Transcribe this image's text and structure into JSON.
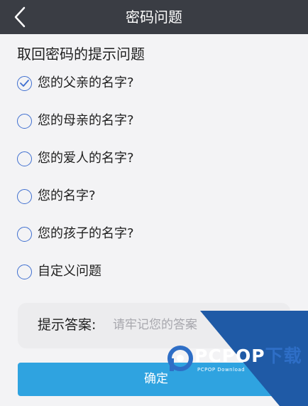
{
  "header": {
    "title": "密码问题",
    "back_icon": "chevron-left-icon"
  },
  "section": {
    "title": "取回密码的提示问题"
  },
  "options": [
    {
      "label": "您的父亲的名字?",
      "selected": true
    },
    {
      "label": "您的母亲的名字?",
      "selected": false
    },
    {
      "label": "您的爱人的名字?",
      "selected": false
    },
    {
      "label": "您的名字?",
      "selected": false
    },
    {
      "label": "您的孩子的名字?",
      "selected": false
    },
    {
      "label": "自定义问题",
      "selected": false
    }
  ],
  "answer": {
    "label": "提示答案:",
    "placeholder": "请牢记您的答案",
    "value": ""
  },
  "confirm": {
    "label": "确定"
  },
  "watermark": {
    "brand_prefix": "PCPOP",
    "brand_suffix": "下载",
    "subtitle": "PCPOP Download"
  },
  "colors": {
    "header_bg": "#3a3d44",
    "accent": "#3f6fd0",
    "button_bg": "#2fa3e0",
    "page_bg": "#f3f3f5",
    "watermark_blue": "#1f5aa6"
  }
}
